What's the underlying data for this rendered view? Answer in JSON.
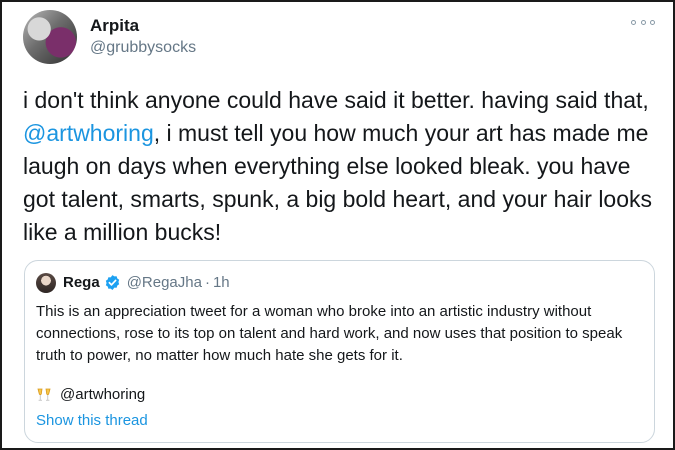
{
  "tweet": {
    "author_name": "Arpita",
    "author_handle": "@grubbysocks",
    "more_icon": "more-options-icon",
    "text_before": "i don't think anyone could have said it better. having said that, ",
    "mention": "@artwhoring",
    "text_after": ", i must tell you how much your art has made me laugh on days when everything else looked bleak. you have got talent, smarts, spunk, a big bold heart, and your hair looks like a million bucks!"
  },
  "quoted": {
    "author_name": "Rega",
    "verified_icon": "verified-badge-icon",
    "author_handle": "@RegaJha",
    "separator": "·",
    "time": "1h",
    "text": "This is an appreciation tweet for a woman who broke into an artistic industry without connections, rose to its top on talent and hard work, and now uses that position to speak truth to power, no matter how much hate she gets for it.",
    "emoji_icon": "clinking-glasses-icon",
    "mention": "@artwhoring",
    "show_thread": "Show this thread"
  },
  "colors": {
    "link": "#1b95e0",
    "secondary_text": "#657786",
    "border": "#ccd6dd",
    "verified": "#1da1f2"
  }
}
